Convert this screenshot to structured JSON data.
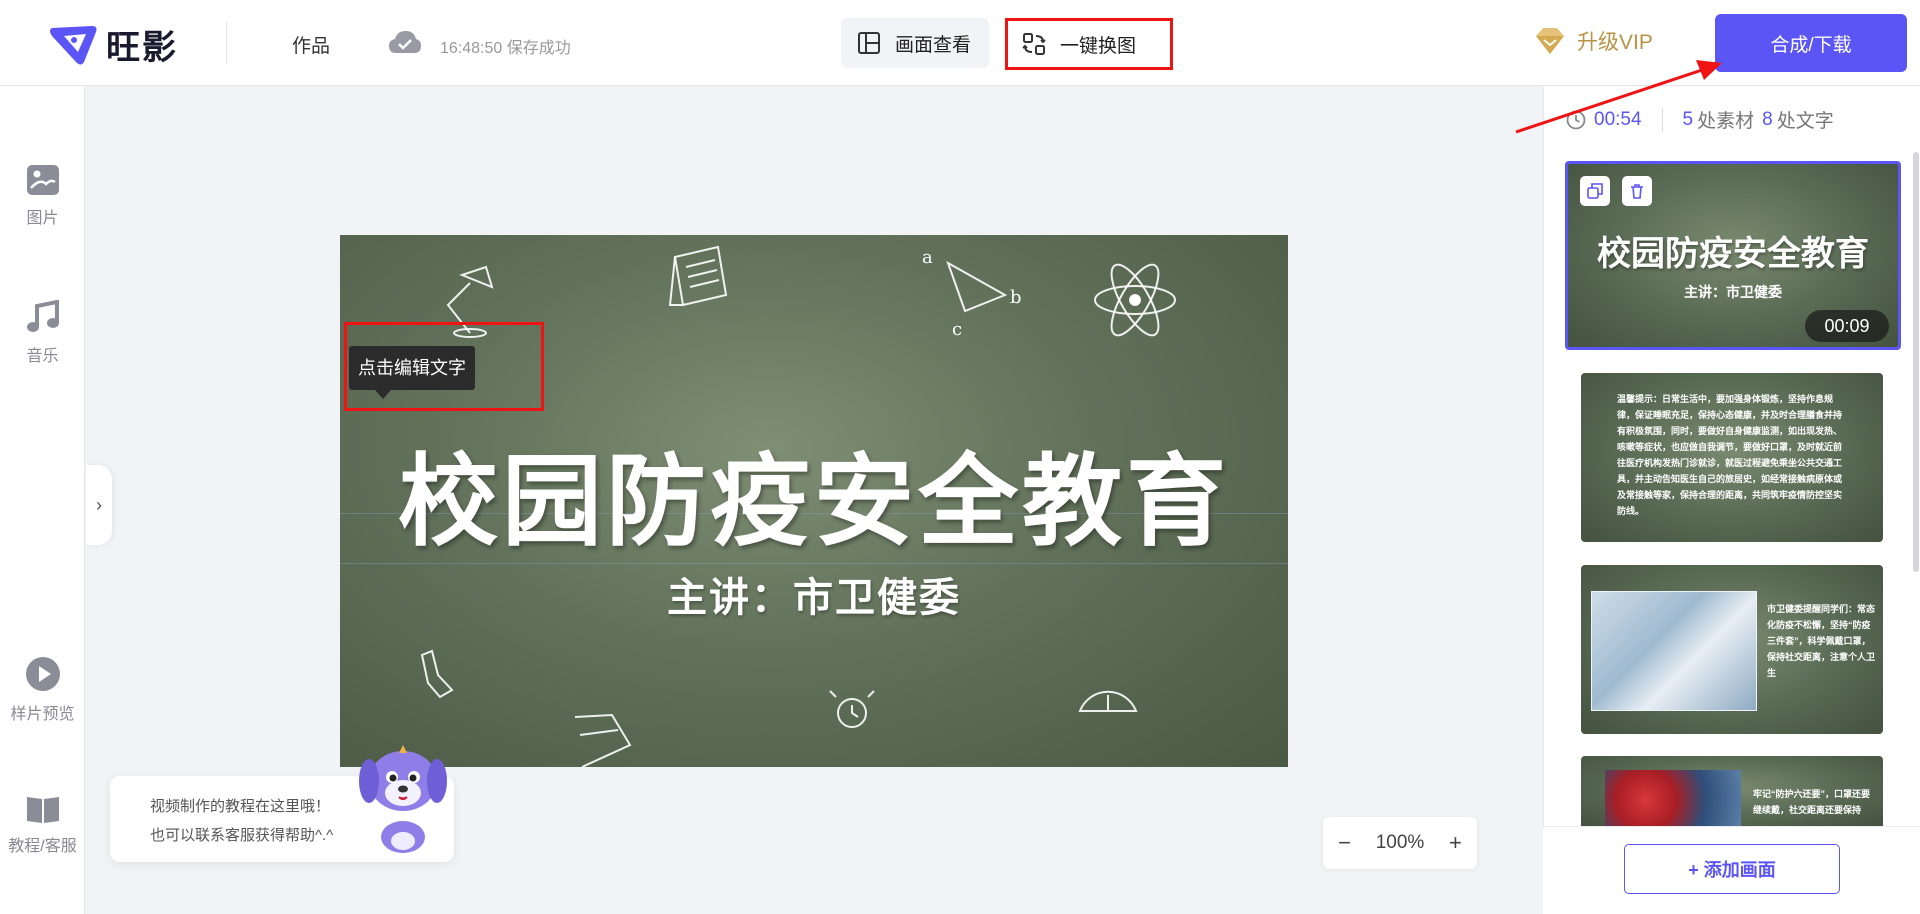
{
  "header": {
    "brand": "旺影",
    "works_label": "作品",
    "save_status": "16:48:50 保存成功",
    "preview_label": "画面查看",
    "swap_label": "一键换图",
    "vip_label": "升级VIP",
    "export_label": "合成/下载"
  },
  "sidebar": {
    "items": [
      {
        "label": "图片",
        "icon": "image-icon"
      },
      {
        "label": "音乐",
        "icon": "music-icon"
      },
      {
        "label": "样片预览",
        "icon": "play-icon"
      },
      {
        "label": "教程/客服",
        "icon": "book-icon"
      }
    ],
    "collapse_glyph": "›"
  },
  "canvas": {
    "title": "校园防疫安全教育",
    "subtitle": "主讲：市卫健委",
    "tooltip": "点击编辑文字",
    "doodle_letters": {
      "a": "a",
      "b": "b",
      "c": "c"
    }
  },
  "help": {
    "line1": "视频制作的教程在这里哦！",
    "line2": "也可以联系客服获得帮助^.^"
  },
  "zoom": {
    "minus": "−",
    "value": "100%",
    "plus": "+"
  },
  "right_panel": {
    "duration": "00:54",
    "material_count": "5",
    "material_label": "处素材",
    "text_count": "8",
    "text_label": "处文字",
    "thumbnails": [
      {
        "title": "校园防疫安全教育",
        "subtitle": "主讲：市卫健委",
        "duration": "00:09"
      },
      {
        "text": "温馨提示：日常生活中，要加强身体锻炼，坚持作息规律，保证睡眠充足，保持心态健康，并及时合理膳食并持有积极氛围，同时，要做好自身健康监测，如出现发热、咳嗽等症状，也应做自我调节，要做好口罩，及时就近前往医疗机构发热门诊就诊，就医过程避免乘坐公共交通工具，并主动告知医生自己的旅居史，如经常接触病原体或及常接触等家，保持合理的距离，共同筑牢疫情防控坚实防线。"
      },
      {
        "text": "市卫健委提醒同学们：常态化防疫不松懈，坚持“防疫三件套”，科学佩戴口罩，保持社交距离，注意个人卫生"
      },
      {
        "text": "牢记“防护六还要”，口罩还要继续戴，社交距离还要保持"
      }
    ],
    "add_label": "+ 添加画面"
  },
  "colors": {
    "accent": "#5b55f5",
    "highlight_red": "#f01313",
    "vip_gold": "#b89245",
    "chalkboard": "#61715a"
  }
}
